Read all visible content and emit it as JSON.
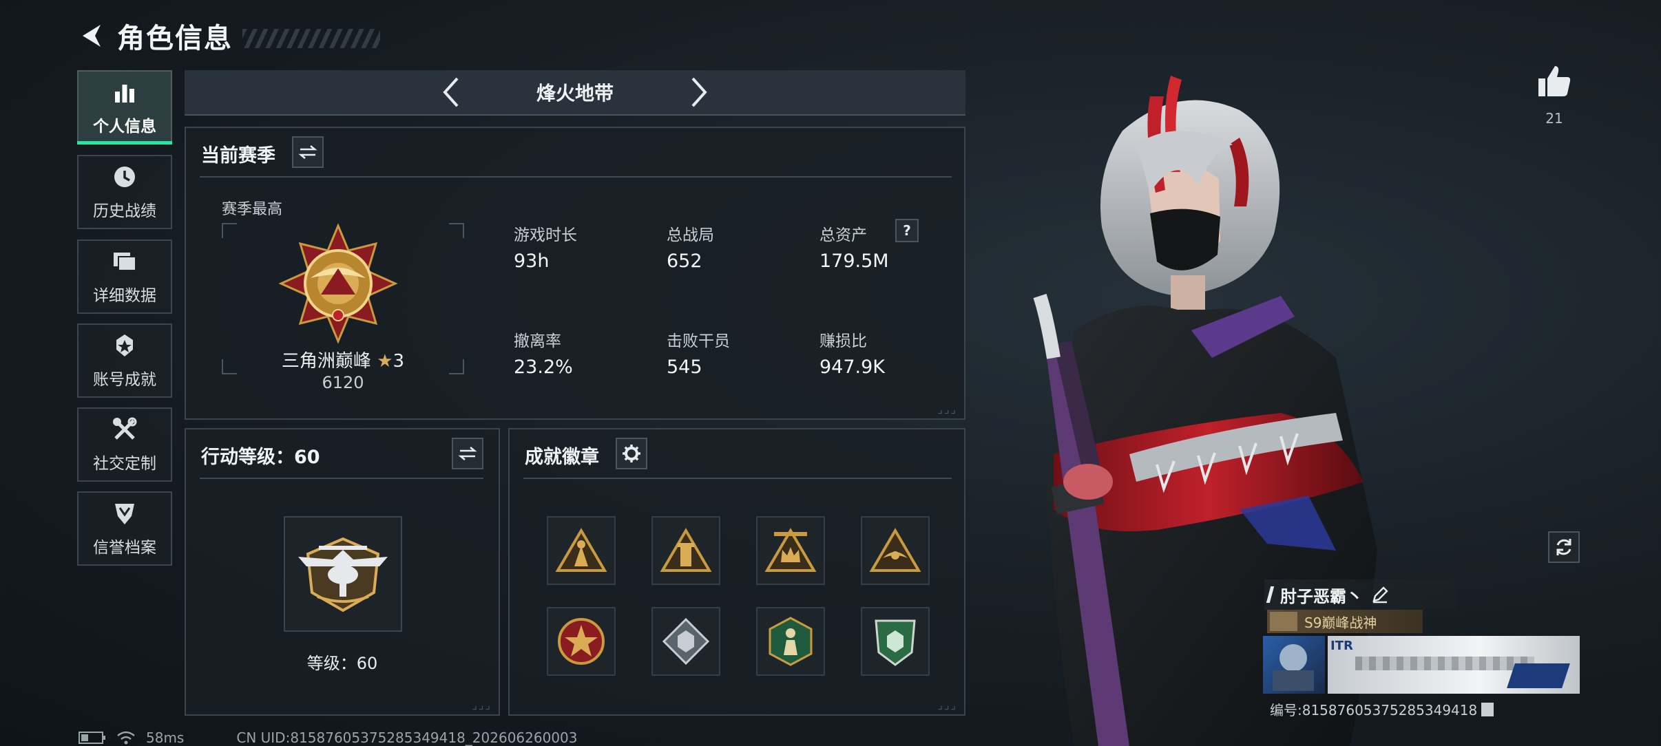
{
  "header": {
    "title": "角色信息"
  },
  "sidebar": {
    "items": [
      {
        "label": "个人信息",
        "icon": "bar-chart-icon",
        "active": true
      },
      {
        "label": "历史战绩",
        "icon": "history-clock-icon"
      },
      {
        "label": "详细数据",
        "icon": "folder-icon"
      },
      {
        "label": "账号成就",
        "icon": "achievement-icon"
      },
      {
        "label": "社交定制",
        "icon": "tools-icon"
      },
      {
        "label": "信誉档案",
        "icon": "shield-rank-icon"
      }
    ]
  },
  "mode": {
    "title": "烽火地带"
  },
  "season": {
    "title": "当前赛季",
    "best_label": "赛季最高",
    "rank_name": "三角洲巅峰",
    "rank_stars": "3",
    "rank_score": "6120",
    "stats": [
      {
        "label": "游戏时长",
        "value": "93h"
      },
      {
        "label": "总战局",
        "value": "652"
      },
      {
        "label": "总资产",
        "value": "179.5M",
        "help": "?"
      },
      {
        "label": "撤离率",
        "value": "23.2%"
      },
      {
        "label": "击败干员",
        "value": "545"
      },
      {
        "label": "赚损比",
        "value": "947.9K"
      }
    ]
  },
  "action_level": {
    "title": "行动等级：60",
    "level_label": "等级：60"
  },
  "badges": {
    "title": "成就徽章",
    "items": [
      {
        "icon": "gold-triangle-badge-icon"
      },
      {
        "icon": "gold-tower-badge-icon"
      },
      {
        "icon": "gold-crown-badge-icon"
      },
      {
        "icon": "gold-eagle-badge-icon"
      },
      {
        "icon": "star-emblem-badge-icon"
      },
      {
        "icon": "diamond-badge-icon"
      },
      {
        "icon": "green-hexagon-badge-icon"
      },
      {
        "icon": "green-shield-badge-icon"
      }
    ]
  },
  "likes": {
    "count": "21"
  },
  "profile": {
    "name": "肘子恶霸丶",
    "title_tag": "S9巅峰战神",
    "card_text": "ITR",
    "id_text": "编号:8158760537528534941​8"
  },
  "status": {
    "ping": "58ms",
    "uid": "CN UID:8158760537528534941​8_202606260003"
  },
  "colors": {
    "accent": "#23e6a1",
    "gold": "#c99a3e",
    "panel_border": "#3b454d"
  }
}
